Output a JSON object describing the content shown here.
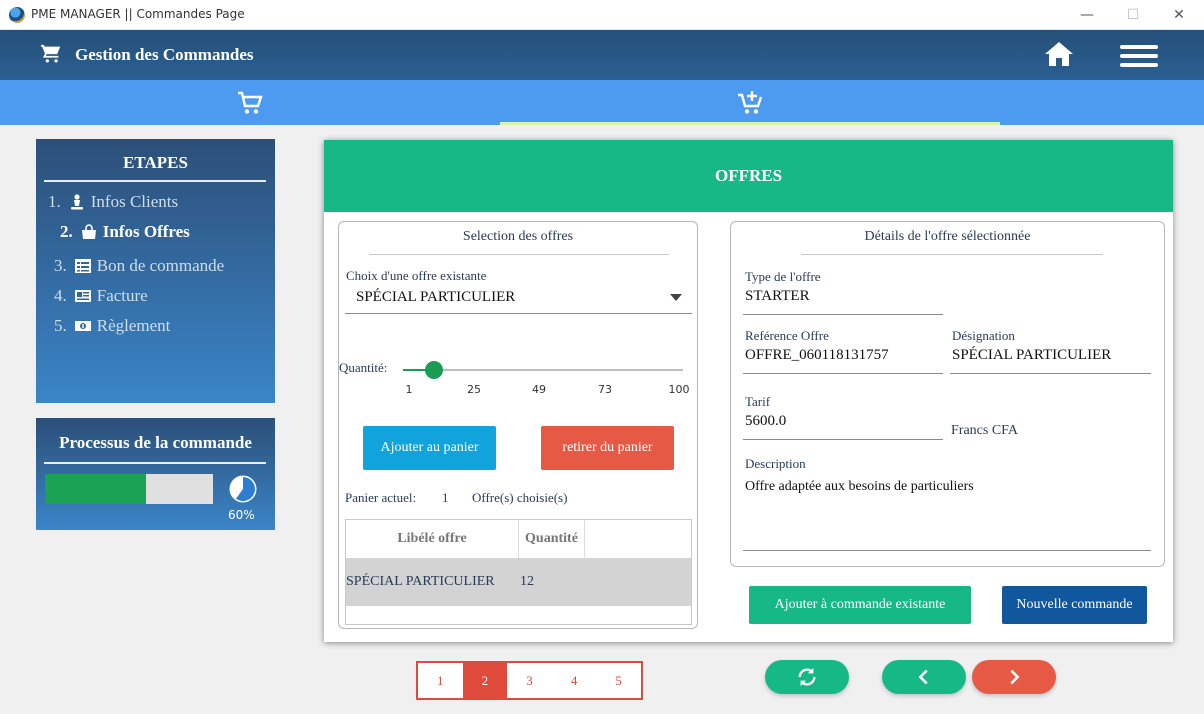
{
  "window": {
    "title": "PME MANAGER || Commandes Page",
    "minimize": "—",
    "maximize": "☐",
    "close": "✕"
  },
  "header": {
    "title": "Gestion des Commandes",
    "icons": [
      "cart-icon",
      "home-icon",
      "hamburger-menu-icon"
    ]
  },
  "tabs": [
    {
      "icon": "cart-icon",
      "active": false
    },
    {
      "icon": "cart-add-icon",
      "active": true
    }
  ],
  "steps": {
    "title": "ETAPES",
    "items": [
      {
        "num": "1.",
        "label": "Infos Clients",
        "icon": "person-icon",
        "active": false
      },
      {
        "num": "2.",
        "label": "Infos Offres",
        "icon": "shopping-bag-icon",
        "active": true
      },
      {
        "num": "3.",
        "label": "Bon de commande",
        "icon": "list-icon",
        "active": false
      },
      {
        "num": "4.",
        "label": "Facture",
        "icon": "newspaper-icon",
        "active": false
      },
      {
        "num": "5.",
        "label": "Règlement",
        "icon": "money-icon",
        "active": false
      }
    ]
  },
  "process": {
    "title": "Processus de la commande",
    "progress": 0.6,
    "percent_label": "60%",
    "colors": {
      "fill": "#1aa354",
      "track": "#e0e0e0"
    }
  },
  "offres": {
    "title": "OFFRES",
    "selection": {
      "title": "Selection des offres",
      "choice_label": "Choix d'une offre existante",
      "choice_value": "SPÉCIAL PARTICULIER",
      "quantity_label": "Quantité:",
      "slider": {
        "min": 1,
        "max": 100,
        "value": 12,
        "ticks": [
          "1",
          "25",
          "49",
          "73",
          "100"
        ]
      },
      "add_button": "Ajouter au panier",
      "remove_button": "retirer du panier",
      "cart_label": "Panier actuel:",
      "cart_count": "1",
      "cart_suffix": "Offre(s) choisie(s)",
      "table": {
        "columns": [
          "Libélé offre",
          "Quantité"
        ],
        "rows": [
          {
            "offre": "SPÉCIAL PARTICULIER",
            "quantite": "12"
          }
        ]
      }
    },
    "details": {
      "title": "Détails de l'offre sélectionnée",
      "type_label": "Type de l'offre",
      "type_value": "STARTER",
      "ref_label": "Reférence Offre",
      "ref_value": "OFFRE_060118131757",
      "designation_label": "Désignation",
      "designation_value": "SPÉCIAL PARTICULIER",
      "tarif_label": "Tarif",
      "tarif_value": "5600.0",
      "currency": "Francs CFA",
      "description_label": "Description",
      "description_value": "Offre adaptée aux besoins de particuliers"
    },
    "actions": {
      "existing": "Ajouter à commande existante",
      "new": "Nouvelle commande"
    }
  },
  "pager": {
    "pages": [
      "1",
      "2",
      "3",
      "4",
      "5"
    ],
    "current": "2"
  },
  "nav": {
    "icons": [
      "refresh-icon",
      "chevron-left-icon",
      "chevron-right-icon"
    ]
  },
  "colors": {
    "header": "#2b5f92",
    "tabbar": "#4d9bf0",
    "green": "#16b885",
    "red": "#e65a45",
    "blue": "#11a3dc",
    "navy": "#11579e"
  }
}
